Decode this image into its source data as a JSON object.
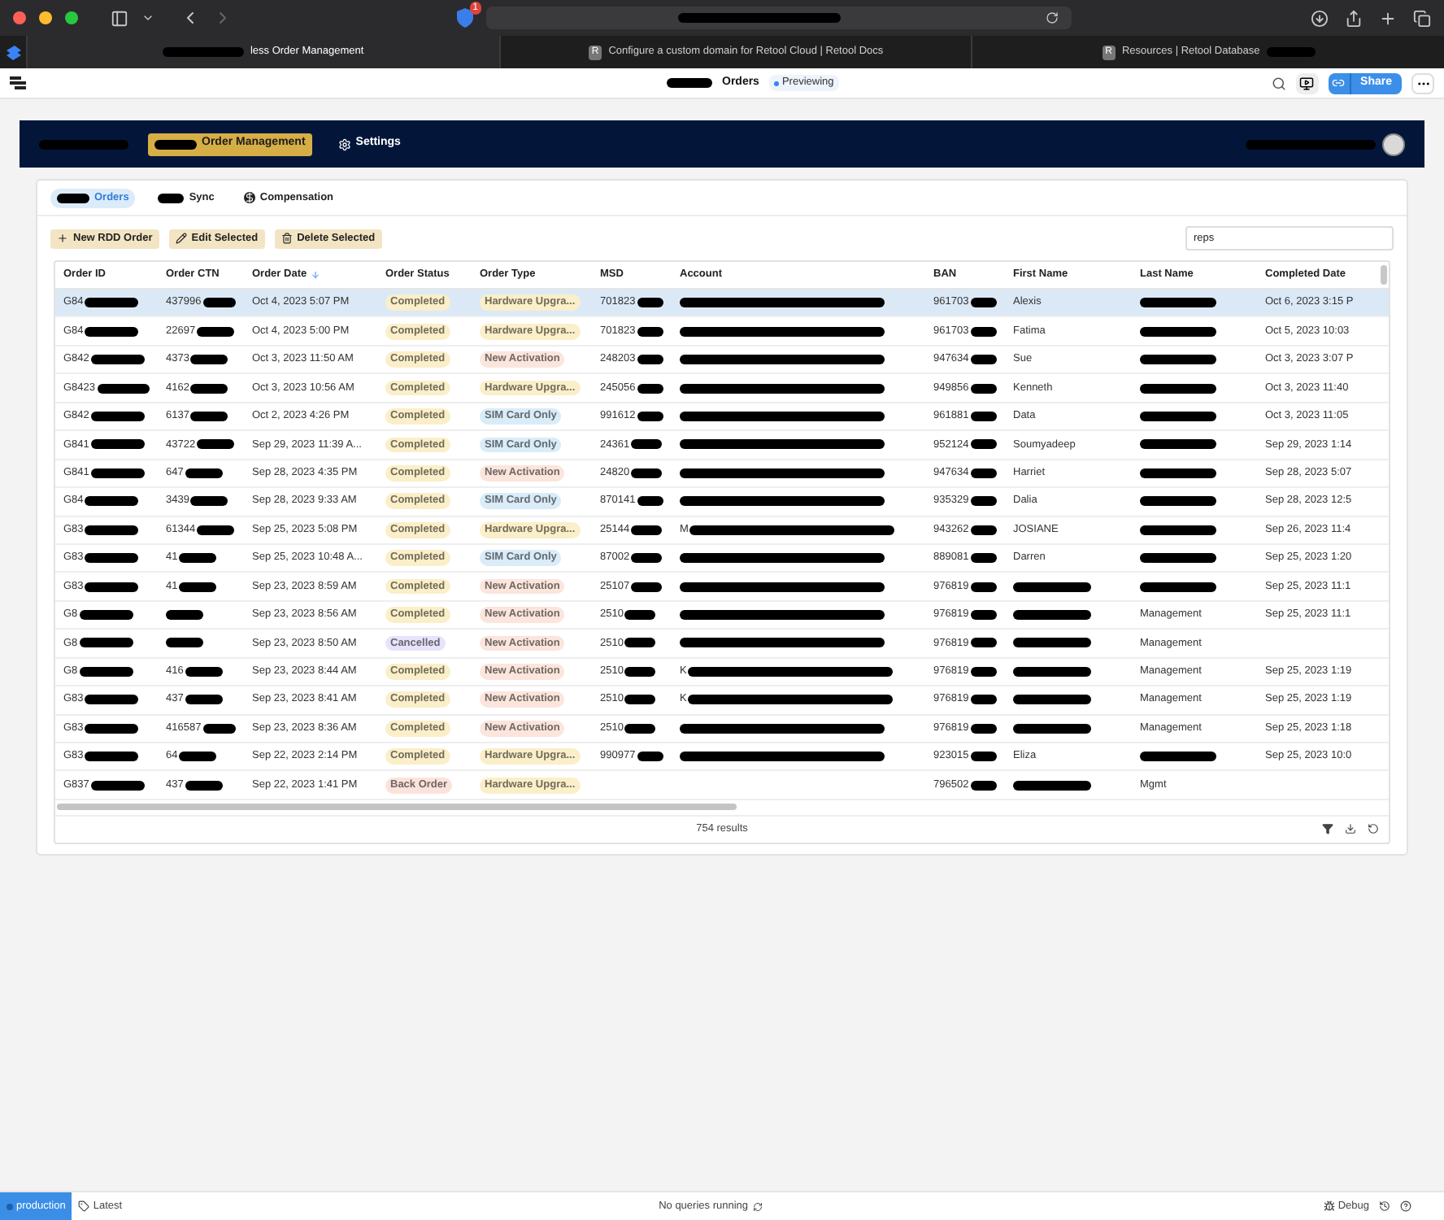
{
  "browser": {
    "tab_badge": "1",
    "tabs": [
      {
        "title": "less Order Management",
        "selected": true
      },
      {
        "title": "Configure a custom domain for Retool Cloud | Retool Docs",
        "selected": false,
        "icon_text": "R"
      },
      {
        "title": "Resources | Retool Database",
        "selected": false,
        "icon_text": "R"
      }
    ]
  },
  "app_header": {
    "title": "Orders",
    "mode": "Previewing",
    "share": "Share"
  },
  "banner": {
    "nav": [
      {
        "label": "Order Management",
        "selected": true
      },
      {
        "label": "Settings",
        "selected": false
      }
    ]
  },
  "tabs": [
    {
      "label": "Orders",
      "selected": true
    },
    {
      "label": "Sync",
      "selected": false
    },
    {
      "label": "Compensation",
      "selected": false
    }
  ],
  "toolbar": {
    "buttons": [
      "New RDD Order",
      "Edit Selected",
      "Delete Selected"
    ],
    "search": {
      "value": "reps"
    }
  },
  "table": {
    "columns": [
      {
        "label": "Order ID",
        "sorted": false
      },
      {
        "label": "Order CTN",
        "sorted": false
      },
      {
        "label": "Order Date",
        "sorted": true
      },
      {
        "label": "Order Status",
        "sorted": false
      },
      {
        "label": "Order Type",
        "sorted": false
      },
      {
        "label": "MSD",
        "sorted": false
      },
      {
        "label": "Account",
        "sorted": false
      },
      {
        "label": "BAN",
        "sorted": false
      },
      {
        "label": "First Name",
        "sorted": false
      },
      {
        "label": "Last Name",
        "sorted": false
      },
      {
        "label": "Completed Date",
        "sorted": false
      }
    ],
    "rows": [
      {
        "selected": true,
        "cells": [
          {
            "text": "G84",
            "redacted": true
          },
          {
            "text": "437996",
            "redacted": true
          },
          "Oct 4, 2023 5:07 PM",
          {
            "text": "Completed",
            "color": "#fbefc9"
          },
          {
            "text": "Hardware Upgra...",
            "color": "#fbefc9"
          },
          {
            "text": "701823",
            "redacted": true
          },
          {
            "redacted": true
          },
          {
            "text": "961703",
            "redacted": true
          },
          "Alexis",
          {
            "redacted": true
          },
          "Oct 6, 2023 3:15 P"
        ]
      },
      {
        "selected": false,
        "cells": [
          {
            "text": "G84",
            "redacted": true
          },
          {
            "text": "22697",
            "redacted": true
          },
          "Oct 4, 2023 5:00 PM",
          {
            "text": "Completed",
            "color": "#fbefc9"
          },
          {
            "text": "Hardware Upgra...",
            "color": "#fbefc9"
          },
          {
            "text": "701823",
            "redacted": true
          },
          {
            "redacted": true
          },
          {
            "text": "961703",
            "redacted": true
          },
          "Fatima",
          {
            "redacted": true
          },
          "Oct 5, 2023 10:03"
        ]
      },
      {
        "selected": false,
        "cells": [
          {
            "text": "G842",
            "redacted": true
          },
          {
            "text": "4373",
            "redacted": true
          },
          "Oct 3, 2023 11:50 AM",
          {
            "text": "Completed",
            "color": "#fbefc9"
          },
          {
            "text": "New Activation",
            "color": "#fbe5dc"
          },
          {
            "text": "248203",
            "redacted": true
          },
          {
            "redacted": true
          },
          {
            "text": "947634",
            "redacted": true
          },
          "Sue",
          {
            "redacted": true
          },
          "Oct 3, 2023 3:07 P"
        ]
      },
      {
        "selected": false,
        "cells": [
          {
            "text": "G8423",
            "redacted": true
          },
          {
            "text": "4162",
            "redacted": true
          },
          "Oct 3, 2023 10:56 AM",
          {
            "text": "Completed",
            "color": "#fbefc9"
          },
          {
            "text": "Hardware Upgra...",
            "color": "#fbefc9"
          },
          {
            "text": "245056",
            "redacted": true
          },
          {
            "redacted": true
          },
          {
            "text": "949856",
            "redacted": true
          },
          "Kenneth",
          {
            "redacted": true
          },
          "Oct 3, 2023 11:40"
        ]
      },
      {
        "selected": false,
        "cells": [
          {
            "text": "G842",
            "redacted": true
          },
          {
            "text": "6137",
            "redacted": true
          },
          "Oct 2, 2023 4:26 PM",
          {
            "text": "Completed",
            "color": "#fbefc9"
          },
          {
            "text": "SIM Card Only",
            "color": "#d9ecf8"
          },
          {
            "text": "991612",
            "redacted": true
          },
          {
            "redacted": true
          },
          {
            "text": "961881",
            "redacted": true
          },
          "Data",
          {
            "redacted": true
          },
          "Oct 3, 2023 11:05"
        ]
      },
      {
        "selected": false,
        "cells": [
          {
            "text": "G841",
            "redacted": true
          },
          {
            "text": "43722",
            "redacted": true
          },
          "Sep 29, 2023 11:39 A...",
          {
            "text": "Completed",
            "color": "#fbefc9"
          },
          {
            "text": "SIM Card Only",
            "color": "#d9ecf8"
          },
          {
            "text": "24361",
            "redacted": true
          },
          {
            "redacted": true
          },
          {
            "text": "952124",
            "redacted": true
          },
          "Soumyadeep",
          {
            "redacted": true
          },
          "Sep 29, 2023 1:14"
        ]
      },
      {
        "selected": false,
        "cells": [
          {
            "text": "G841",
            "redacted": true
          },
          {
            "text": "647",
            "redacted": true
          },
          "Sep 28, 2023 4:35 PM",
          {
            "text": "Completed",
            "color": "#fbefc9"
          },
          {
            "text": "New Activation",
            "color": "#fbe5dc"
          },
          {
            "text": "24820",
            "redacted": true
          },
          {
            "redacted": true
          },
          {
            "text": "947634",
            "redacted": true
          },
          "Harriet",
          {
            "redacted": true
          },
          "Sep 28, 2023 5:07"
        ]
      },
      {
        "selected": false,
        "cells": [
          {
            "text": "G84",
            "redacted": true
          },
          {
            "text": "3439",
            "redacted": true
          },
          "Sep 28, 2023 9:33 AM",
          {
            "text": "Completed",
            "color": "#fbefc9"
          },
          {
            "text": "SIM Card Only",
            "color": "#d9ecf8"
          },
          {
            "text": "870141",
            "redacted": true
          },
          {
            "redacted": true
          },
          {
            "text": "935329",
            "redacted": true
          },
          "Dalia",
          {
            "redacted": true
          },
          "Sep 28, 2023 12:5"
        ]
      },
      {
        "selected": false,
        "cells": [
          {
            "text": "G83",
            "redacted": true
          },
          {
            "text": "61344",
            "redacted": true
          },
          "Sep 25, 2023 5:08 PM",
          {
            "text": "Completed",
            "color": "#fbefc9"
          },
          {
            "text": "Hardware Upgra...",
            "color": "#fbefc9"
          },
          {
            "text": "25144",
            "redacted": true
          },
          {
            "text": "M",
            "redacted": true
          },
          {
            "text": "943262",
            "redacted": true
          },
          "JOSIANE",
          {
            "redacted": true
          },
          "Sep 26, 2023 11:4"
        ]
      },
      {
        "selected": false,
        "cells": [
          {
            "text": "G83",
            "redacted": true
          },
          {
            "text": "41",
            "redacted": true
          },
          "Sep 25, 2023 10:48 A...",
          {
            "text": "Completed",
            "color": "#fbefc9"
          },
          {
            "text": "SIM Card Only",
            "color": "#d9ecf8"
          },
          {
            "text": "87002",
            "redacted": true
          },
          {
            "redacted": true
          },
          {
            "text": "889081",
            "redacted": true
          },
          "Darren",
          {
            "redacted": true
          },
          "Sep 25, 2023 1:20"
        ]
      },
      {
        "selected": false,
        "cells": [
          {
            "text": "G83",
            "redacted": true
          },
          {
            "text": "41",
            "redacted": true
          },
          "Sep 23, 2023 8:59 AM",
          {
            "text": "Completed",
            "color": "#fbefc9"
          },
          {
            "text": "New Activation",
            "color": "#fbe5dc"
          },
          {
            "text": "25107",
            "redacted": true
          },
          {
            "redacted": true
          },
          {
            "text": "976819",
            "redacted": true
          },
          {
            "redacted": true
          },
          {
            "redacted": true
          },
          "Sep 25, 2023 11:1"
        ]
      },
      {
        "selected": false,
        "cells": [
          {
            "text": "G8",
            "redacted": true
          },
          {
            "redacted": true
          },
          "Sep 23, 2023 8:56 AM",
          {
            "text": "Completed",
            "color": "#fbefc9"
          },
          {
            "text": "New Activation",
            "color": "#fbe5dc"
          },
          {
            "text": "2510",
            "redacted": true
          },
          {
            "redacted": true
          },
          {
            "text": "976819",
            "redacted": true
          },
          {
            "redacted": true
          },
          "Management",
          "Sep 25, 2023 11:1"
        ]
      },
      {
        "selected": false,
        "cells": [
          {
            "text": "G8",
            "redacted": true
          },
          {
            "redacted": true
          },
          "Sep 23, 2023 8:50 AM",
          {
            "text": "Cancelled",
            "color": "#e8e2fb"
          },
          {
            "text": "New Activation",
            "color": "#fbe5dc"
          },
          {
            "text": "2510",
            "redacted": true
          },
          {
            "redacted": true
          },
          {
            "text": "976819",
            "redacted": true
          },
          {
            "redacted": true
          },
          "Management",
          null
        ]
      },
      {
        "selected": false,
        "cells": [
          {
            "text": "G8",
            "redacted": true
          },
          {
            "text": "416",
            "redacted": true
          },
          "Sep 23, 2023 8:44 AM",
          {
            "text": "Completed",
            "color": "#fbefc9"
          },
          {
            "text": "New Activation",
            "color": "#fbe5dc"
          },
          {
            "text": "2510",
            "redacted": true
          },
          {
            "text": "K",
            "redacted": true
          },
          {
            "text": "976819",
            "redacted": true
          },
          {
            "redacted": true
          },
          "Management",
          "Sep 25, 2023 1:19"
        ]
      },
      {
        "selected": false,
        "cells": [
          {
            "text": "G83",
            "redacted": true
          },
          {
            "text": "437",
            "redacted": true
          },
          "Sep 23, 2023 8:41 AM",
          {
            "text": "Completed",
            "color": "#fbefc9"
          },
          {
            "text": "New Activation",
            "color": "#fbe5dc"
          },
          {
            "text": "2510",
            "redacted": true
          },
          {
            "text": "K",
            "redacted": true
          },
          {
            "text": "976819",
            "redacted": true
          },
          {
            "redacted": true
          },
          "Management",
          "Sep 25, 2023 1:19"
        ]
      },
      {
        "selected": false,
        "cells": [
          {
            "text": "G83",
            "redacted": true
          },
          {
            "text": "416587",
            "redacted": true
          },
          "Sep 23, 2023 8:36 AM",
          {
            "text": "Completed",
            "color": "#fbefc9"
          },
          {
            "text": "New Activation",
            "color": "#fbe5dc"
          },
          {
            "text": "2510",
            "redacted": true
          },
          {
            "redacted": true
          },
          {
            "text": "976819",
            "redacted": true
          },
          {
            "redacted": true
          },
          "Management",
          "Sep 25, 2023 1:18"
        ]
      },
      {
        "selected": false,
        "cells": [
          {
            "text": "G83",
            "redacted": true
          },
          {
            "text": "64",
            "redacted": true
          },
          "Sep 22, 2023 2:14 PM",
          {
            "text": "Completed",
            "color": "#fbefc9"
          },
          {
            "text": "Hardware Upgra...",
            "color": "#fbefc9"
          },
          {
            "text": "990977",
            "redacted": true
          },
          {
            "redacted": true
          },
          {
            "text": "923015",
            "redacted": true
          },
          "Eliza",
          {
            "redacted": true
          },
          "Sep 25, 2023 10:0"
        ]
      },
      {
        "selected": false,
        "cells": [
          {
            "text": "G837",
            "redacted": true
          },
          {
            "text": "437",
            "redacted": true
          },
          "Sep 22, 2023 1:41 PM",
          {
            "text": "Back Order",
            "color": "#fbe3dc"
          },
          {
            "text": "Hardware Upgra...",
            "color": "#fbefc9"
          },
          null,
          null,
          {
            "text": "796502",
            "redacted": true
          },
          {
            "redacted": true
          },
          "Mgmt",
          null
        ]
      }
    ],
    "results": "754 results"
  },
  "status_bar": {
    "environment": "production",
    "version": "Latest",
    "queries": "No queries running",
    "debug": "Debug"
  }
}
